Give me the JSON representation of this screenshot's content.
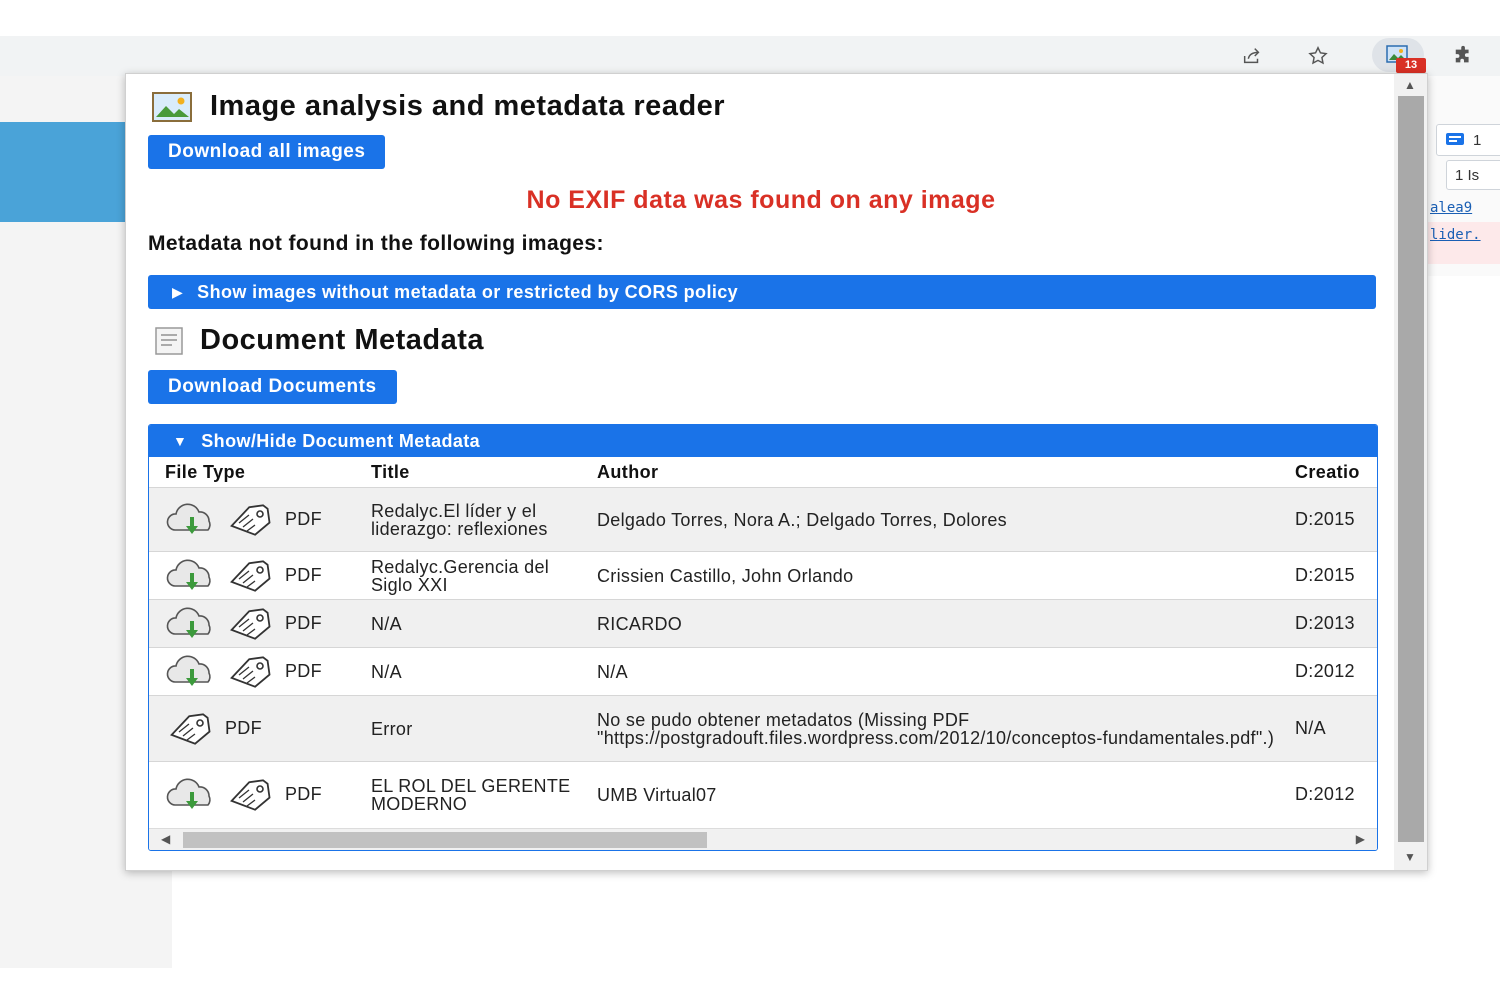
{
  "browser": {
    "toolbar_icons": [
      "share-icon",
      "star-icon",
      "image-analysis-extension-icon",
      "puzzle-icon"
    ],
    "extension_badge": "13"
  },
  "background_page": {
    "chip_1": "1",
    "chip_2": "1 Is",
    "link_1": "alea9",
    "link_2": "lider."
  },
  "popup": {
    "title": "Image analysis and metadata reader",
    "download_images_button": "Download all images",
    "exif_warning": "No EXIF data was found on any image",
    "metadata_not_found_label": "Metadata not found in the following images:",
    "images_summary_toggle": "Show images without metadata or restricted by CORS policy",
    "doc_title": "Document Metadata",
    "download_documents_button": "Download Documents",
    "doc_toggle": "Show/Hide Document Metadata",
    "columns": {
      "file_type": "File Type",
      "title": "Title",
      "author": "Author",
      "creation": "Creatio"
    },
    "rows": [
      {
        "type": "PDF",
        "title": "Redalyc.El líder y el liderazgo: reflexiones",
        "author": "Delgado Torres, Nora A.; Delgado Torres, Dolores",
        "creation": "D:2015"
      },
      {
        "type": "PDF",
        "title": "Redalyc.Gerencia del Siglo XXI",
        "author": "Crissien Castillo, John Orlando",
        "creation": "D:2015"
      },
      {
        "type": "PDF",
        "title": "N/A",
        "author": "RICARDO",
        "creation": "D:2013"
      },
      {
        "type": "PDF",
        "title": "N/A",
        "author": "N/A",
        "creation": "D:2012"
      },
      {
        "type": "PDF",
        "title": "Error",
        "author": "No se pudo obtener metadatos (Missing PDF \"https://postgradouft.files.wordpress.com/2012/10/conceptos-fundamentales.pdf\".)",
        "creation": "N/A"
      },
      {
        "type": "PDF",
        "title": "EL ROL DEL GERENTE MODERNO",
        "author": "UMB Virtual07",
        "creation": "D:2012"
      }
    ]
  }
}
